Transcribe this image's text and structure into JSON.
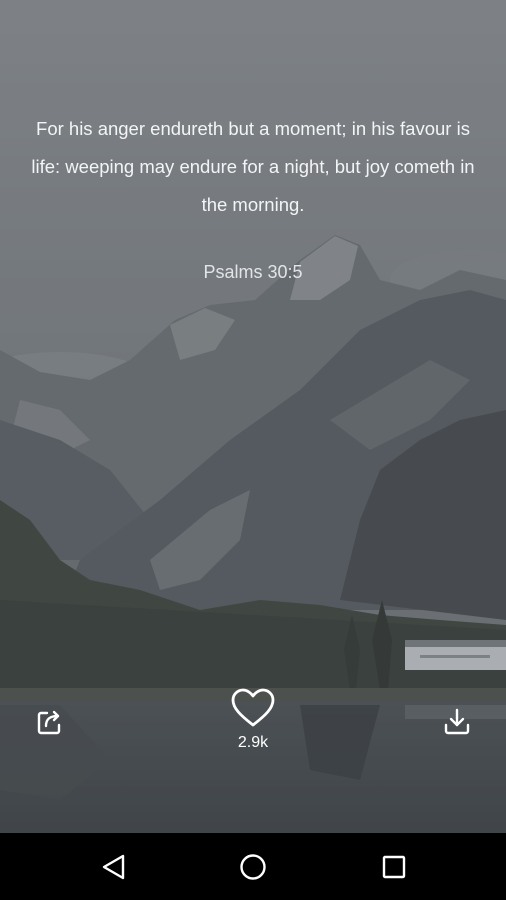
{
  "quote": {
    "text": "For his anger endureth but a moment; in his favour is life: weeping may endure for a night, but joy cometh in the morning.",
    "reference": "Psalms 30:5"
  },
  "actions": {
    "share_icon": "share-icon",
    "like_icon": "heart-icon",
    "like_count": "2.9k",
    "download_icon": "download-icon"
  },
  "background": {
    "subject": "mountain lake landscape",
    "overlay_color": "#5c6166"
  },
  "navbar": {
    "back_icon": "back-triangle-icon",
    "home_icon": "home-circle-icon",
    "recent_icon": "recent-apps-square-icon"
  }
}
